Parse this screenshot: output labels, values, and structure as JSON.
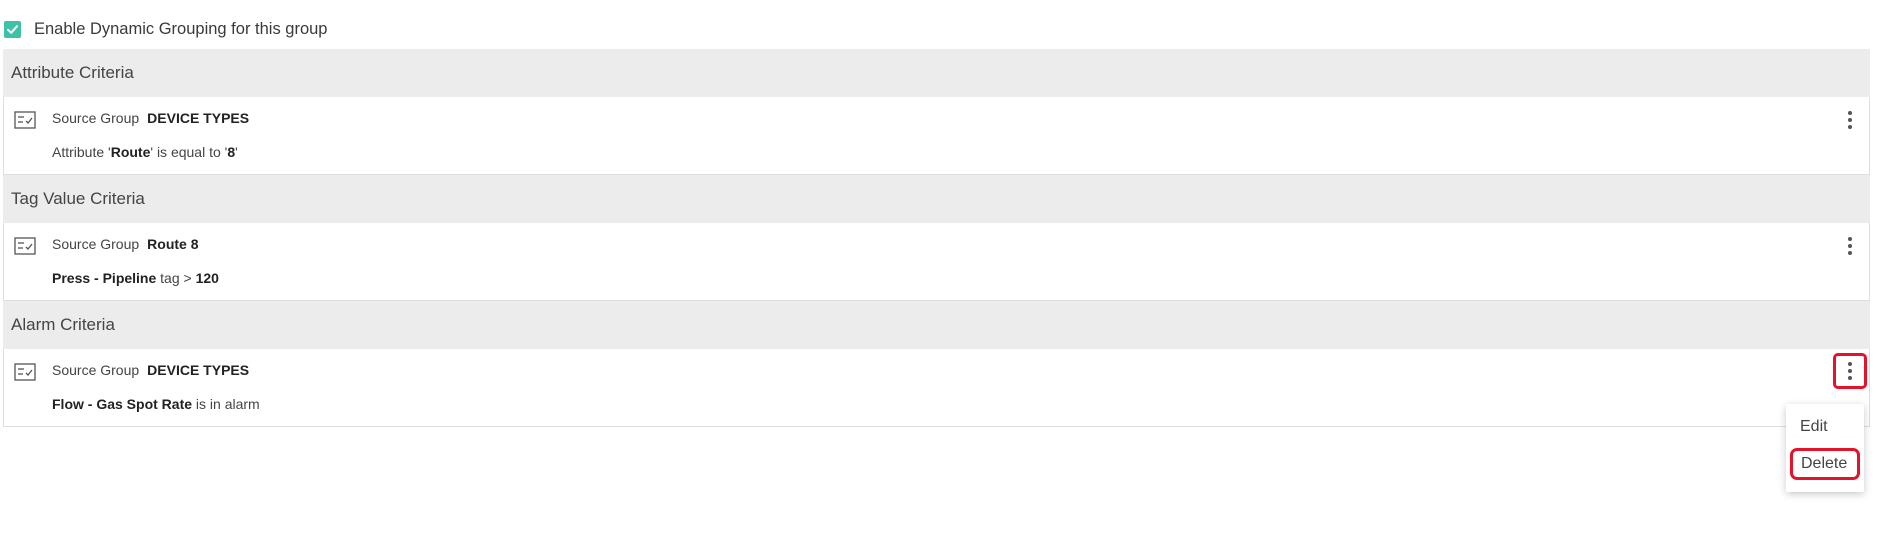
{
  "enable_checkbox": {
    "label": "Enable Dynamic Grouping for this group",
    "checked": true
  },
  "sections": [
    {
      "header": "Attribute Criteria",
      "card": {
        "source_label": "Source Group",
        "source_group": "DEVICE TYPES",
        "line2": {
          "t1": "Attribute '",
          "b1": "Route",
          "t2": "' is equal to '",
          "b2": "8",
          "t3": "'"
        }
      }
    },
    {
      "header": "Tag Value Criteria",
      "card": {
        "source_label": "Source Group",
        "source_group": "Route 8",
        "line2": {
          "b1": "Press - Pipeline",
          "t1": " tag > ",
          "b2": "120"
        }
      }
    },
    {
      "header": "Alarm Criteria",
      "card": {
        "source_label": "Source Group",
        "source_group": "DEVICE TYPES",
        "line2": {
          "b1": "Flow - Gas Spot Rate",
          "t1": " is in alarm"
        }
      }
    }
  ],
  "context_menu": {
    "items": [
      "Edit",
      "Delete"
    ]
  },
  "colors": {
    "accent": "#3ec1a7",
    "highlight": "#e3142a",
    "header_bg": "#ececec"
  }
}
